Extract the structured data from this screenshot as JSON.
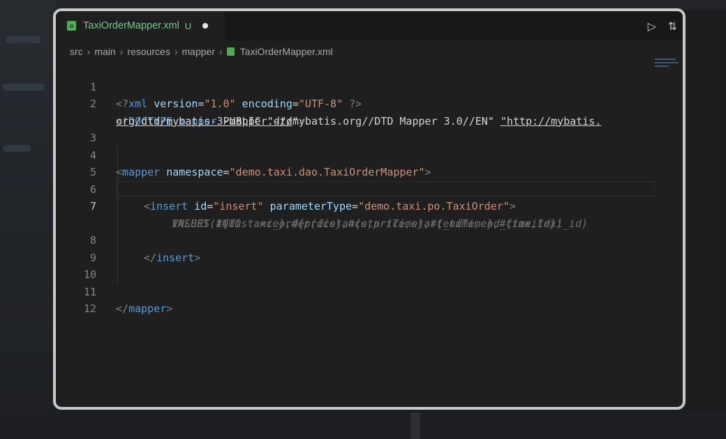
{
  "tab": {
    "filename": "TaxiOrderMapper.xml",
    "status_badge": "U"
  },
  "toolbar": {
    "run_icon": "play-icon",
    "compare_icon": "compare-changes-icon"
  },
  "breadcrumb": [
    "src",
    "main",
    "resources",
    "mapper",
    "TaxiOrderMapper.xml"
  ],
  "editor": {
    "active_line": 7,
    "line_numbers": [
      "1",
      "2",
      "3",
      "4",
      "5",
      "6",
      "7",
      "8",
      "9",
      "10",
      "11",
      "12"
    ],
    "code": {
      "l1": {
        "open": "<?",
        "tag": "xml",
        "a1": "version",
        "eq1": "=",
        "v1": "\"1.0\"",
        "a2": "encoding",
        "eq2": "=",
        "v2": "\"UTF-8\"",
        "close": " ?>"
      },
      "l2": {
        "open": "<!",
        "doctype": "DOCTYPE",
        "tag": "mapper",
        "pub": "PUBLIC",
        "fpi": "\"-//mybatis.org//DTD Mapper 3.0//EN\"",
        "url_part1": "\"http://mybatis.",
        "url_part2": "org/dtd/mybatis-3-mapper.dtd",
        "url_end": "\"",
        "close": ">"
      },
      "l4": {
        "open": "<",
        "tag": "mapper",
        "attr": "namespace",
        "eq": "=",
        "val": "\"demo.taxi.dao.TaxiOrderMapper\"",
        "close": ">"
      },
      "l6": {
        "open": "<",
        "tag": "insert",
        "a1": "id",
        "eq1": "=",
        "v1": "\"insert\"",
        "a2": "parameterType",
        "eq2": "=",
        "v2": "\"demo.taxi.po.TaxiOrder\"",
        "close": ">"
      },
      "l7": "INSERT INTO taxi_order(distance,price,start_time,end_time,taxi_id)",
      "l7b": "VALUES(#{distance},#{price},#{startTime},#{endTime},#{taxiId})",
      "l8": {
        "open": "</",
        "tag": "insert",
        "close": ">"
      },
      "l11": {
        "open": "</",
        "tag": "mapper",
        "close": ">"
      }
    }
  }
}
